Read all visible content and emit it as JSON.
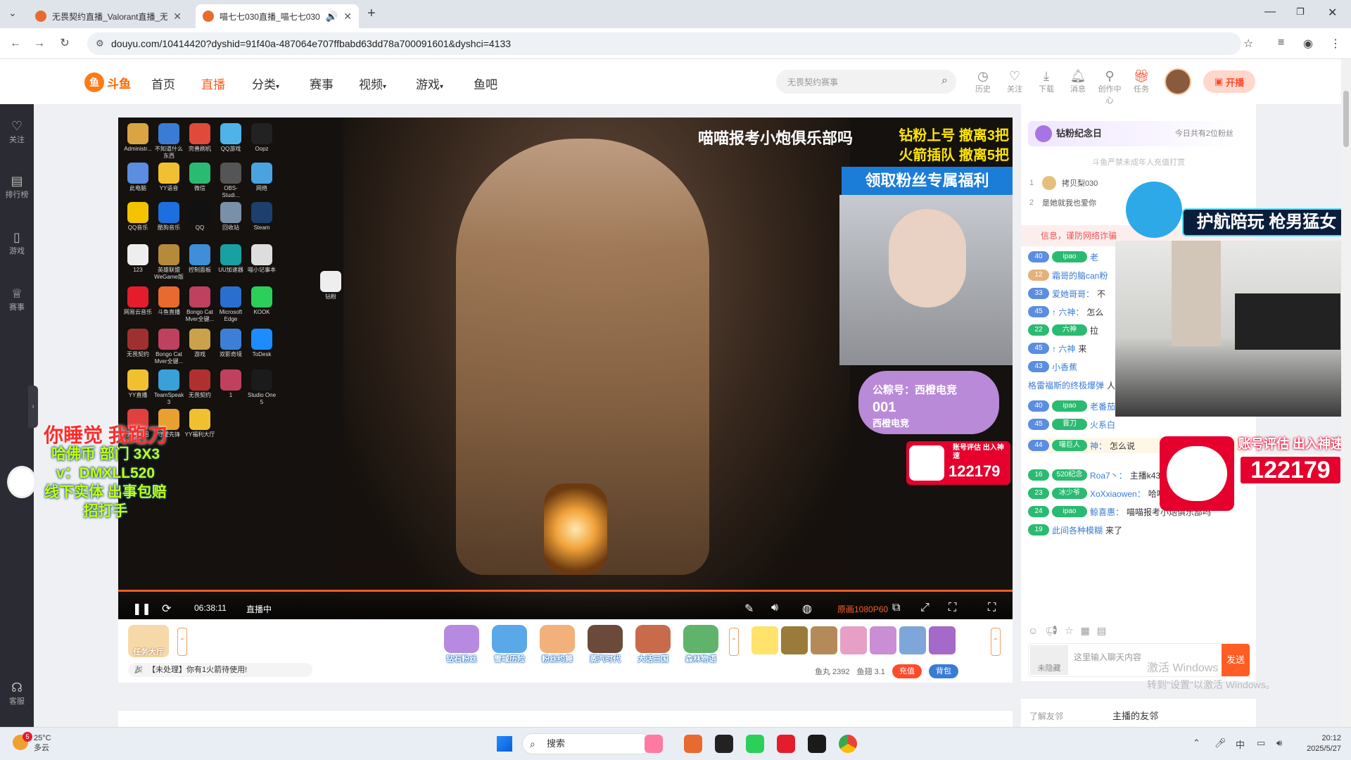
{
  "browser": {
    "tabs": [
      {
        "title": "无畏契约直播_Valorant直播_无",
        "active": false
      },
      {
        "title": "喵七七030直播_喵七七030",
        "active": true
      }
    ],
    "url": "douyu.com/10414420?dyshid=91f40a-487064e707ffbabd63dd78a700091601&dyshci=4133"
  },
  "site": {
    "logo_text": "斗鱼",
    "logo_sub": "DOUYU.COM",
    "nav": [
      {
        "label": "首页",
        "active": false
      },
      {
        "label": "直播",
        "active": true
      },
      {
        "label": "分类",
        "active": false
      },
      {
        "label": "赛事",
        "active": false
      },
      {
        "label": "视频",
        "active": false
      },
      {
        "label": "游戏",
        "active": false
      },
      {
        "label": "鱼吧",
        "active": false
      }
    ],
    "search_placeholder": "无畏契约赛事",
    "header_icons": [
      {
        "label": "历史",
        "icon": "clock-icon"
      },
      {
        "label": "关注",
        "icon": "heart-icon"
      },
      {
        "label": "下载",
        "icon": "download-icon"
      },
      {
        "label": "消息",
        "icon": "bell-icon"
      },
      {
        "label": "创作中心",
        "icon": "bulb-icon"
      },
      {
        "label": "任务",
        "icon": "gift-icon"
      }
    ],
    "kaibo_label": "开播"
  },
  "left_sidebar": [
    {
      "label": "关注",
      "icon": "heart-icon"
    },
    {
      "label": "排行榜",
      "icon": "rank-icon"
    },
    {
      "label": "游戏",
      "icon": "gamepad-icon"
    },
    {
      "label": "赛事",
      "icon": "trophy-icon"
    },
    {
      "label": "客服",
      "icon": "headset-icon"
    }
  ],
  "video": {
    "title_overlay": "喵喵报考小炮俱乐部吗",
    "overlay_lines": [
      "钻粉上号 撤离3把",
      "火箭插队 撤离5把"
    ],
    "fan_banner": "领取粉丝专属福利",
    "badge_line1": "公粽号：西橙电竞",
    "badge_num": "001",
    "badge_brand": "西橙电竞",
    "panda_text": "账号评估 出入神速",
    "panda_num": "122179",
    "overlay_left": [
      "你睡觉 我跑刀",
      "哈佛币 部门 3X3",
      "v：DMXLL520",
      "线下实体 出事包赔",
      "招打手"
    ],
    "desktop_icons": [
      "Administr...",
      "不知道什么东西",
      "完善刷机",
      "QQ游戏",
      "Oopz",
      "此电脑",
      "YY语音",
      "微信",
      "OBS-Studi...",
      "网络",
      "QQ音乐",
      "酷狗音乐",
      "QQ",
      "回收站",
      "Steam",
      "123",
      "英雄联盟WeGame版",
      "控制面板",
      "UU加速器",
      "喵小记事本",
      "网易云音乐",
      "斗鱼直播",
      "Bongo Cat Mver全键...",
      "Microsoft Edge",
      "KOOK",
      "无畏契约",
      "Bongo Cat Mver全键...",
      "游戏",
      "双影奇境",
      "ToDesk",
      "YY直播",
      "TeamSpeak 3",
      "无畏契约",
      "1",
      "Studio One 5",
      "无畏伴侣",
      "守望先锋",
      "YY福利大厅",
      "钻粉"
    ],
    "time": "06:38:11",
    "status": "直播中",
    "quality": "原画1080P60",
    "progress": 1.0
  },
  "below_video": {
    "task_hall": "任务大厅",
    "gifts": [
      "钻石粉丝",
      "雪域历险",
      "粉丝约舞",
      "蒸汽时代",
      "大话三国",
      "森林物语"
    ],
    "notice": "【未处理】你有1火箭待使用!",
    "yuwan": "鱼丸 2392",
    "yuchi": "鱼翅 3.1",
    "recharge": "充值",
    "backpack": "背包"
  },
  "chat_panel": {
    "fan_day": "钻粉纪念日",
    "fan_day_right": "今日共有2位粉丝",
    "minor_notice": "斗鱼严禁未成年人充值打赏",
    "ranks": [
      {
        "no": "1",
        "name": "拷贝梨030"
      },
      {
        "no": "2",
        "name": "是她就我也爱你"
      }
    ],
    "warning": "信息，谨防网络诈骗",
    "messages": [
      {
        "lv": "40",
        "badge": "ipao",
        "user": "老",
        "text": ""
      },
      {
        "lv": "12",
        "badge": "",
        "user": "霜哥的脑can粉",
        "text": ""
      },
      {
        "lv": "33",
        "badge": "",
        "user": "爱她哥哥：",
        "text": "不"
      },
      {
        "lv": "45",
        "badge": "",
        "user": "↑ 六神：",
        "text": "怎么"
      },
      {
        "lv": "22",
        "badge": "六神",
        "user": "",
        "text": "拉"
      },
      {
        "lv": "45",
        "badge": "",
        "user": "↑ 六神",
        "text": "来"
      },
      {
        "lv": "43",
        "badge": "",
        "user": "小香蕉",
        "text": ""
      },
      {
        "lv": "",
        "badge": "",
        "user": "格雷福斯的终极爆弹",
        "text": "人"
      },
      {
        "lv": "40",
        "badge": "ipao",
        "user": "老番茄Criss：",
        "text": ""
      },
      {
        "lv": "45",
        "badge": "晋刀",
        "user": "火系白",
        "text": ""
      },
      {
        "lv": "44",
        "badge": "喵巨人",
        "user": "神：",
        "text": "怎么说"
      },
      {
        "lv": "16",
        "badge": "520纪念",
        "user": "Roa7丶：",
        "text": "主播k437这把枪如何"
      },
      {
        "lv": "23",
        "badge": "冰少爷",
        "user": "XoXxiaowen：",
        "text": "哈哈哈"
      },
      {
        "lv": "24",
        "badge": "ipao",
        "user": "鲸喜惠：",
        "text": "喵喵报考小炮俱乐部吗"
      },
      {
        "lv": "19",
        "badge": "",
        "user": "此间各种模糊",
        "text": "来了"
      }
    ],
    "input_placeholder": "这里输入聊天内容",
    "hide_label": "未隐藏",
    "send_label": "发送",
    "friends_label": "了解友邻",
    "friends_title": "主播的友邻"
  },
  "camera_overlay": {
    "accompany": "护航陪玩 枪男猛女",
    "panda_text": "账号评估 出入神速",
    "panda_num": "122179"
  },
  "watermark": {
    "line1": "激活 Windows",
    "line2": "转到\"设置\"以激活 Windows。"
  },
  "taskbar": {
    "weather_temp": "25°C",
    "weather_desc": "多云",
    "weather_badge": "5",
    "search_label": "搜索",
    "ime": "中",
    "time": "20:12",
    "date": "2025/5/27"
  }
}
